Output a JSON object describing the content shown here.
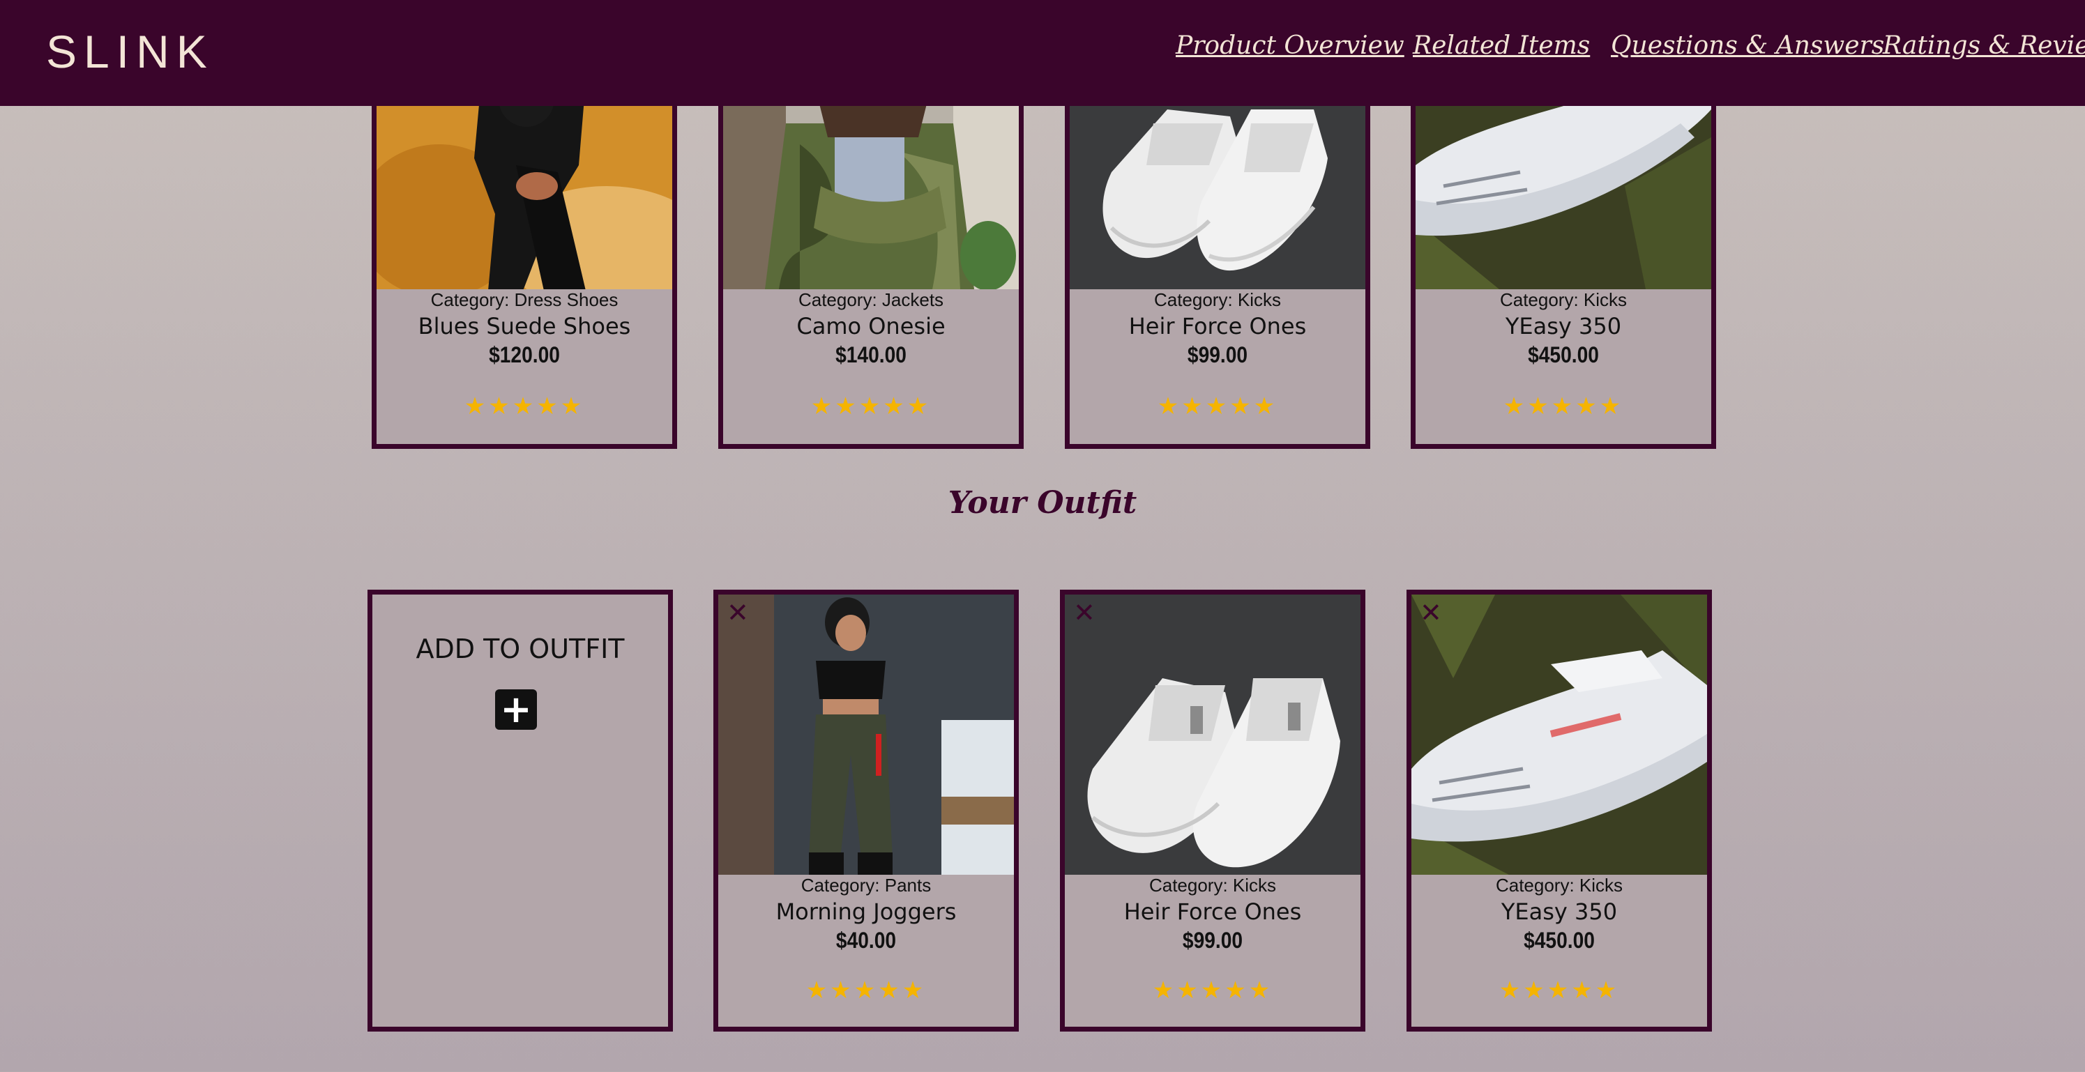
{
  "header": {
    "logo": "SLINK",
    "nav": [
      "Product Overview",
      "Related Items",
      "Questions & Answers",
      "Ratings & Reviews"
    ]
  },
  "related": [
    {
      "category": "Category: Dress Shoes",
      "name": "Blues Suede Shoes",
      "price": "$120.00",
      "rating": 5
    },
    {
      "category": "Category: Jackets",
      "name": "Camo Onesie",
      "price": "$140.00",
      "rating": 5
    },
    {
      "category": "Category: Kicks",
      "name": "Heir Force Ones",
      "price": "$99.00",
      "rating": 5
    },
    {
      "category": "Category: Kicks",
      "name": "YEasy 350",
      "price": "$450.00",
      "rating": 5
    }
  ],
  "outfit": {
    "title": "Your Outfit",
    "add_label": "ADD TO OUTFIT",
    "add_icon": "+",
    "remove_icon": "✕",
    "items": [
      {
        "category": "Category: Pants",
        "name": "Morning Joggers",
        "price": "$40.00",
        "rating": 5
      },
      {
        "category": "Category: Kicks",
        "name": "Heir Force Ones",
        "price": "$99.00",
        "rating": 5
      },
      {
        "category": "Category: Kicks",
        "name": "YEasy 350",
        "price": "$450.00",
        "rating": 5
      }
    ]
  },
  "colors": {
    "brand": "#3a052b",
    "star": "#f5b400",
    "card_bg": "#b3a6aa"
  }
}
